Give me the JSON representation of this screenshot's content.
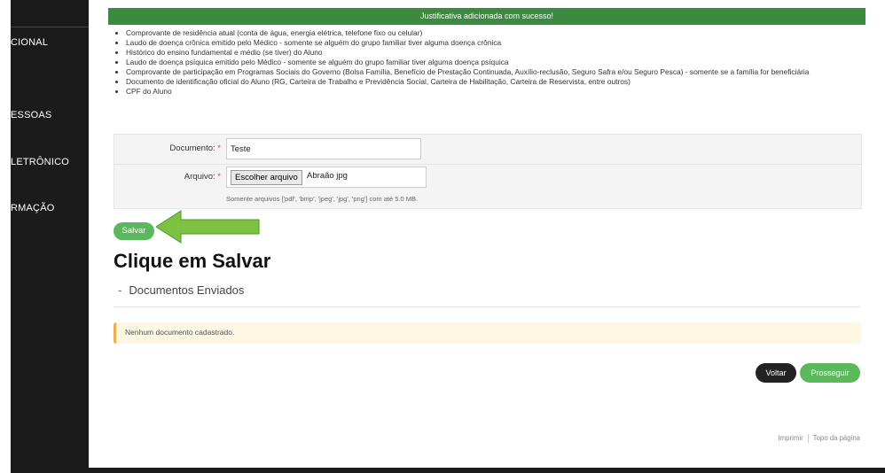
{
  "sidebar": {
    "items": [
      "CIONAL",
      "ESSOAS",
      "LETRÔNICO",
      "RMAÇÃO"
    ]
  },
  "banner": {
    "text": "Justificativa adicionada com sucesso!"
  },
  "requirements": [
    "Comprovante de residência atual (conta de água, energia elétrica, telefone fixo ou celular)",
    "Laudo de doença crônica emitido pelo Médico - somente se alguém do grupo familiar tiver alguma doença crônica",
    "Histórico do ensino fundamental e médio (se tiver) do Aluno",
    "Laudo de doença psíquica emitido pelo Médico - somente se alguém do grupo familiar tiver alguma doença psíquica",
    "Comprovante de participação em Programas Sociais do Governo (Bolsa Família, Benefício de Prestação Continuada, Auxílio-reclusão, Seguro Safra e/ou Seguro Pesca) - somente se a família for beneficiária",
    "Documento de identificação oficial do Aluno (RG, Carteira de Trabalho e Previdência Social, Carteira de Habilitação, Carteira de Reservista, entre outros)",
    "CPF do Aluno"
  ],
  "form": {
    "documento_label": "Documento:",
    "documento_value": "Teste",
    "arquivo_label": "Arquivo:",
    "arquivo_button": "Escolher arquivo",
    "arquivo_filename": "Abraão jpg",
    "arquivo_help": "Somente arquivos ['pdf', 'bmp', 'jpeg', 'jpg', 'png'] com até 5.0 MB.",
    "required_mark": "*"
  },
  "actions": {
    "salvar_label": "Salvar",
    "voltar_label": "Voltar",
    "prosseguir_label": "Prosseguir"
  },
  "annotation": {
    "text": "Clique em Salvar"
  },
  "docs": {
    "title": "Documentos Enviados",
    "empty_message": "Nenhum documento cadastrado."
  },
  "footer": {
    "print_label": "Imprimir",
    "top_label": "Topo da página"
  },
  "colors": {
    "banner": "#3a8a3f",
    "primary_green": "#5cb85c",
    "sidebar": "#1b1b1b",
    "alert_bg": "#fcf8e3",
    "alert_border": "#f0ad4e"
  }
}
